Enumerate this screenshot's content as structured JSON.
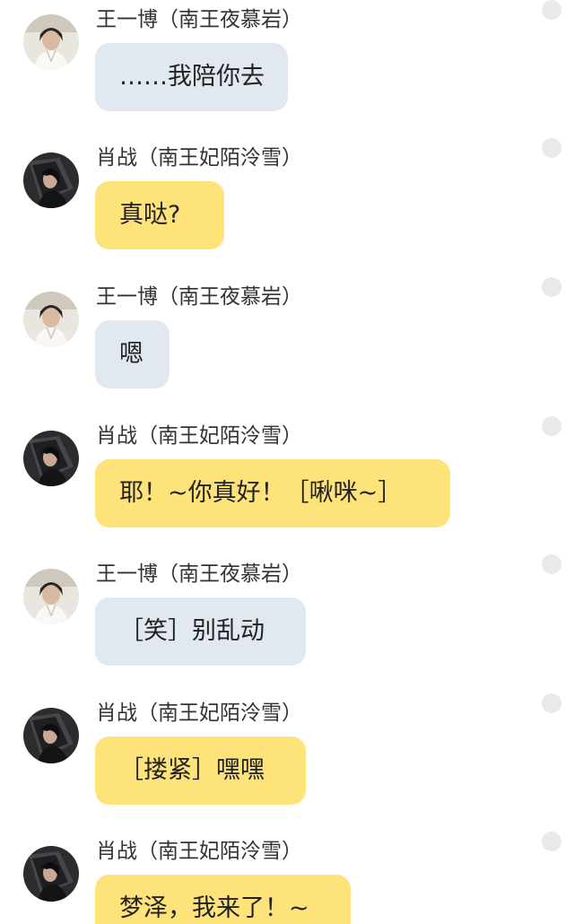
{
  "colors": {
    "bubble_left": "#e1e8f0",
    "bubble_right": "#fee27a",
    "name_text": "#333333",
    "status_dot": "#e9e9e9"
  },
  "messages": [
    {
      "sender": "王一博（南王夜慕岩）",
      "avatar": "avatar-light-costume",
      "text": "……我陪你去",
      "bubble": "gray"
    },
    {
      "sender": "肖战（南王妃陌泠雪）",
      "avatar": "avatar-dark-portrait",
      "text": "真哒?",
      "bubble": "yellow"
    },
    {
      "sender": "王一博（南王夜慕岩）",
      "avatar": "avatar-light-costume",
      "text": "嗯",
      "bubble": "gray"
    },
    {
      "sender": "肖战（南王妃陌泠雪）",
      "avatar": "avatar-dark-portrait",
      "text": "耶！~你真好！［啾咪~］",
      "bubble": "yellow"
    },
    {
      "sender": "王一博（南王夜慕岩）",
      "avatar": "avatar-light-costume",
      "text": "［笑］别乱动",
      "bubble": "gray"
    },
    {
      "sender": "肖战（南王妃陌泠雪）",
      "avatar": "avatar-dark-portrait",
      "text": "［搂紧］嘿嘿",
      "bubble": "yellow"
    },
    {
      "sender": "肖战（南王妃陌泠雪）",
      "avatar": "avatar-dark-portrait",
      "text": "梦泽，我来了！~",
      "bubble": "yellow"
    }
  ]
}
